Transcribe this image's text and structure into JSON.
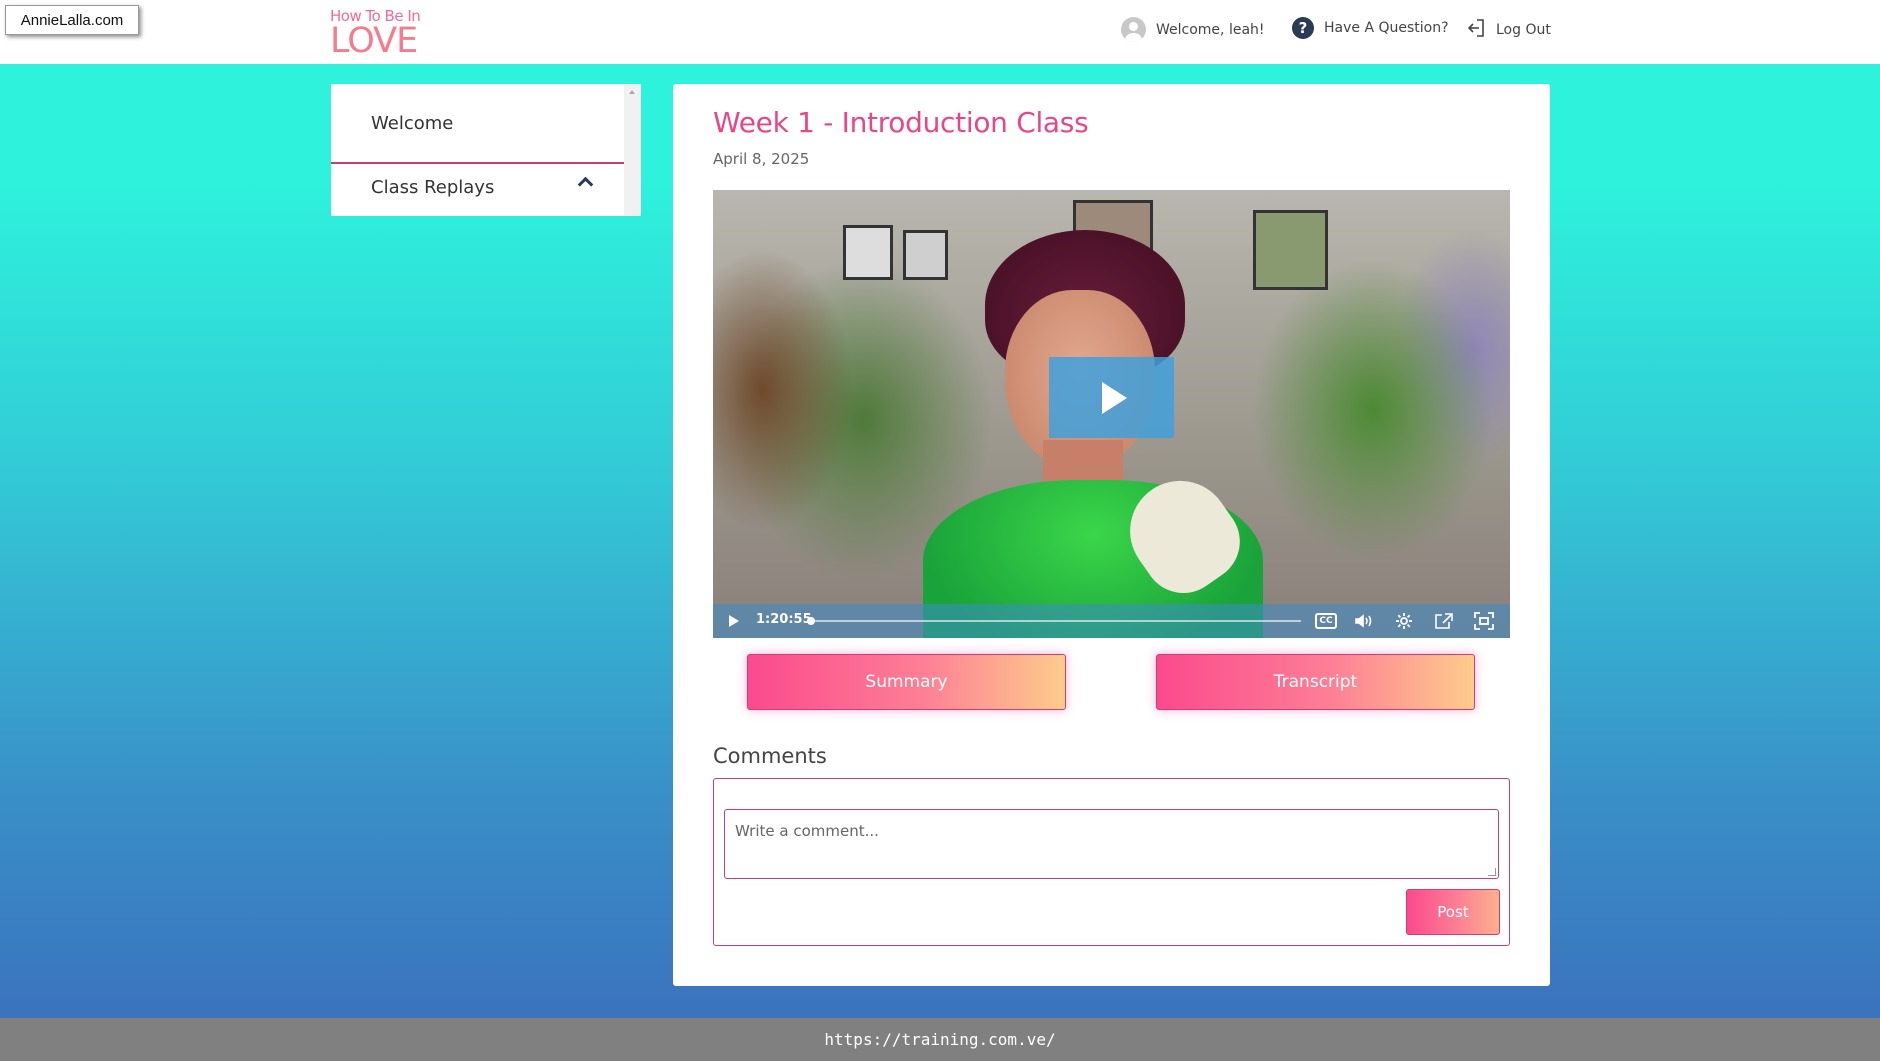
{
  "site_tag": "AnnieLalla.com",
  "logo": {
    "line1": "How To Be In",
    "line2": "LOVE"
  },
  "header": {
    "welcome": "Welcome, leah!",
    "question": "Have A Question?",
    "logout": "Log Out"
  },
  "sidebar": {
    "items": [
      {
        "label": "Welcome"
      },
      {
        "label": "Class Replays",
        "expanded": true
      }
    ]
  },
  "main": {
    "title": "Week 1 - Introduction Class",
    "date": "April 8, 2025",
    "video": {
      "time": "1:20:55",
      "cc_label": "CC",
      "progress": 0.01
    },
    "buttons": {
      "summary": "Summary",
      "transcript": "Transcript"
    },
    "comments": {
      "heading": "Comments",
      "placeholder": "Write a comment...",
      "post_label": "Post"
    }
  },
  "statusbar": {
    "url": "https://training.com.ve/"
  },
  "colors": {
    "accent": "#e8458a",
    "border": "#c2407a",
    "bg_top": "#2ef2dc",
    "bg_bottom": "#3b6dbb"
  }
}
